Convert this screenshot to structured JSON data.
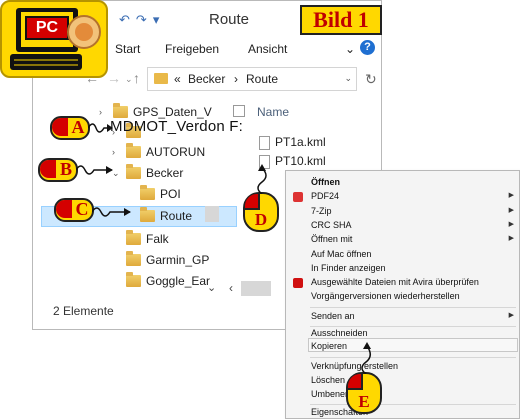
{
  "window": {
    "title": "Route",
    "ribbon_tabs": [
      "Start",
      "Freigeben",
      "Ansicht"
    ],
    "address_crumbs": [
      "«",
      "Becker",
      "›",
      "Route"
    ],
    "status_text": "2 Elemente"
  },
  "tree": [
    {
      "label": "GPS_Daten_V",
      "expander": "›"
    },
    {
      "label": "",
      "expander": "›"
    },
    {
      "label": "AUTORUN",
      "expander": "›"
    },
    {
      "label": "Becker",
      "expander": "⌄"
    },
    {
      "label": "POI",
      "expander": ""
    },
    {
      "label": "Route",
      "expander": ""
    },
    {
      "label": "Falk",
      "expander": ""
    },
    {
      "label": "Garmin_GP",
      "expander": ""
    },
    {
      "label": "Goggle_Ear",
      "expander": ""
    }
  ],
  "overlay_path_text": "MDMOT_Verdon F:",
  "files": {
    "column_name": "Name",
    "items": [
      "PT1a.kml",
      "PT10.kml"
    ]
  },
  "context_menu": {
    "items": [
      {
        "label": "Öffnen",
        "bold": true,
        "arrow": false
      },
      {
        "label": "PDF24",
        "arrow": true
      },
      {
        "label": "7-Zip",
        "arrow": true
      },
      {
        "label": "CRC SHA",
        "arrow": true
      },
      {
        "label": "Öffnen mit",
        "arrow": true
      },
      {
        "label": "Auf Mac öffnen",
        "arrow": false
      },
      {
        "label": "In Finder anzeigen",
        "arrow": false
      },
      {
        "label": "Ausgewählte Dateien mit Avira überprüfen",
        "arrow": false
      },
      {
        "label": "Vorgängerversionen wiederherstellen",
        "arrow": false
      },
      {
        "label": "Senden an",
        "arrow": true
      },
      {
        "label": "Ausschneiden",
        "arrow": false
      },
      {
        "label": "Kopieren",
        "arrow": false
      },
      {
        "label": "Verknüpfung erstellen",
        "arrow": false
      },
      {
        "label": "Löschen",
        "arrow": false
      },
      {
        "label": "Umbenennen",
        "arrow": false
      },
      {
        "label": "Eigenschaften",
        "arrow": false
      }
    ]
  },
  "badges": {
    "pc": "PC",
    "bild": "Bild 1",
    "A": "A",
    "B": "B",
    "C": "C",
    "D": "D",
    "E": "E"
  },
  "colors": {
    "badge_yellow": "#ffd800",
    "badge_red": "#c00000",
    "selection": "#cce8ff"
  }
}
